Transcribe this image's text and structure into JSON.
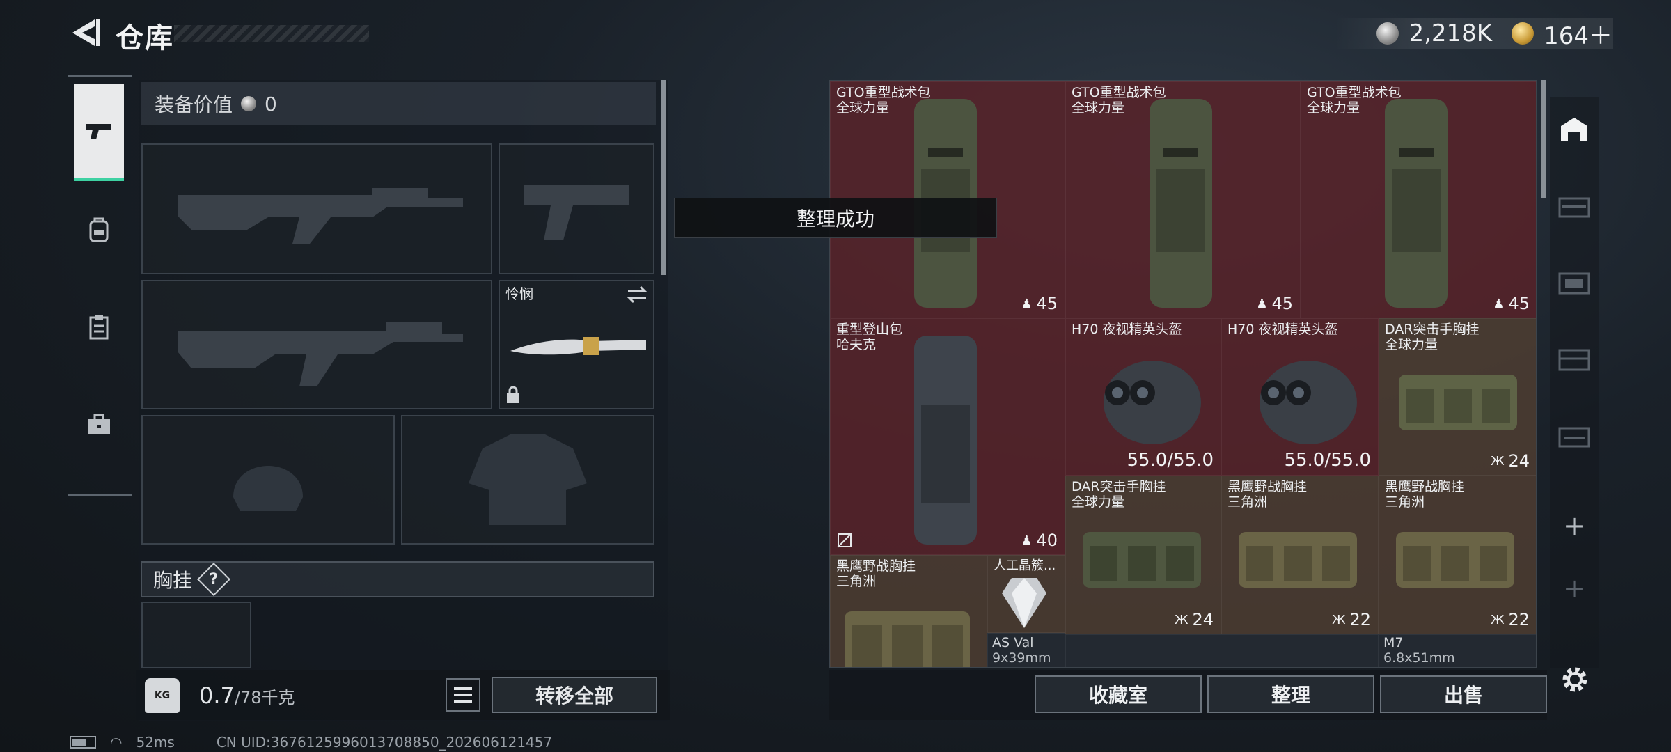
{
  "header": {
    "title": "仓库",
    "currency": [
      {
        "icon": "silver-coin-icon",
        "value": "2,218K"
      },
      {
        "icon": "gold-coin-icon",
        "value": "164＋"
      }
    ]
  },
  "loadout": {
    "value_label": "装备价值",
    "value": "0",
    "knife_name": "怜悯",
    "chest_label": "胸挂",
    "chest_help": "?"
  },
  "toast": "整理成功",
  "storage_items": [
    {
      "name": "GTO重型战术包",
      "sub": "全球力量",
      "count": "45"
    },
    {
      "name": "GTO重型战术包",
      "sub": "全球力量",
      "count": "45"
    },
    {
      "name": "GTO重型战术包",
      "sub": "全球力量",
      "count": "45"
    },
    {
      "name": "重型登山包",
      "sub": "哈夫克",
      "count": "40"
    },
    {
      "name": "H70 夜视精英头盔",
      "sub": "",
      "count": "55.0/55.0"
    },
    {
      "name": "H70 夜视精英头盔",
      "sub": "",
      "count": "55.0/55.0"
    },
    {
      "name": "DAR突击手胸挂",
      "sub": "全球力量",
      "count": "24"
    },
    {
      "name": "DAR突击手胸挂",
      "sub": "全球力量",
      "count": "24"
    },
    {
      "name": "黑鹰野战胸挂",
      "sub": "三角洲",
      "count": "22"
    },
    {
      "name": "黑鹰野战胸挂",
      "sub": "三角洲",
      "count": "22"
    },
    {
      "name": "黑鹰野战胸挂",
      "sub": "三角洲",
      "count": ""
    },
    {
      "name": "人工晶簇...",
      "sub": "",
      "count": ""
    }
  ],
  "ammo": [
    {
      "name": "AS Val",
      "caliber": "9x39mm"
    },
    {
      "name": "M7",
      "caliber": "6.8x51mm"
    }
  ],
  "weight": {
    "current": "0.7",
    "max": "/78千克",
    "icon_text": "KG"
  },
  "buttons": {
    "transfer_all": "转移全部",
    "collection": "收藏室",
    "arrange": "整理",
    "sell": "出售"
  },
  "status": {
    "ping": "52ms",
    "uid": "CN UID:3676125996013708850_202606121457"
  },
  "colors": {
    "accent": "#3ed1a2",
    "red_cell": "#6e2228",
    "brown_cell": "#684a34"
  }
}
